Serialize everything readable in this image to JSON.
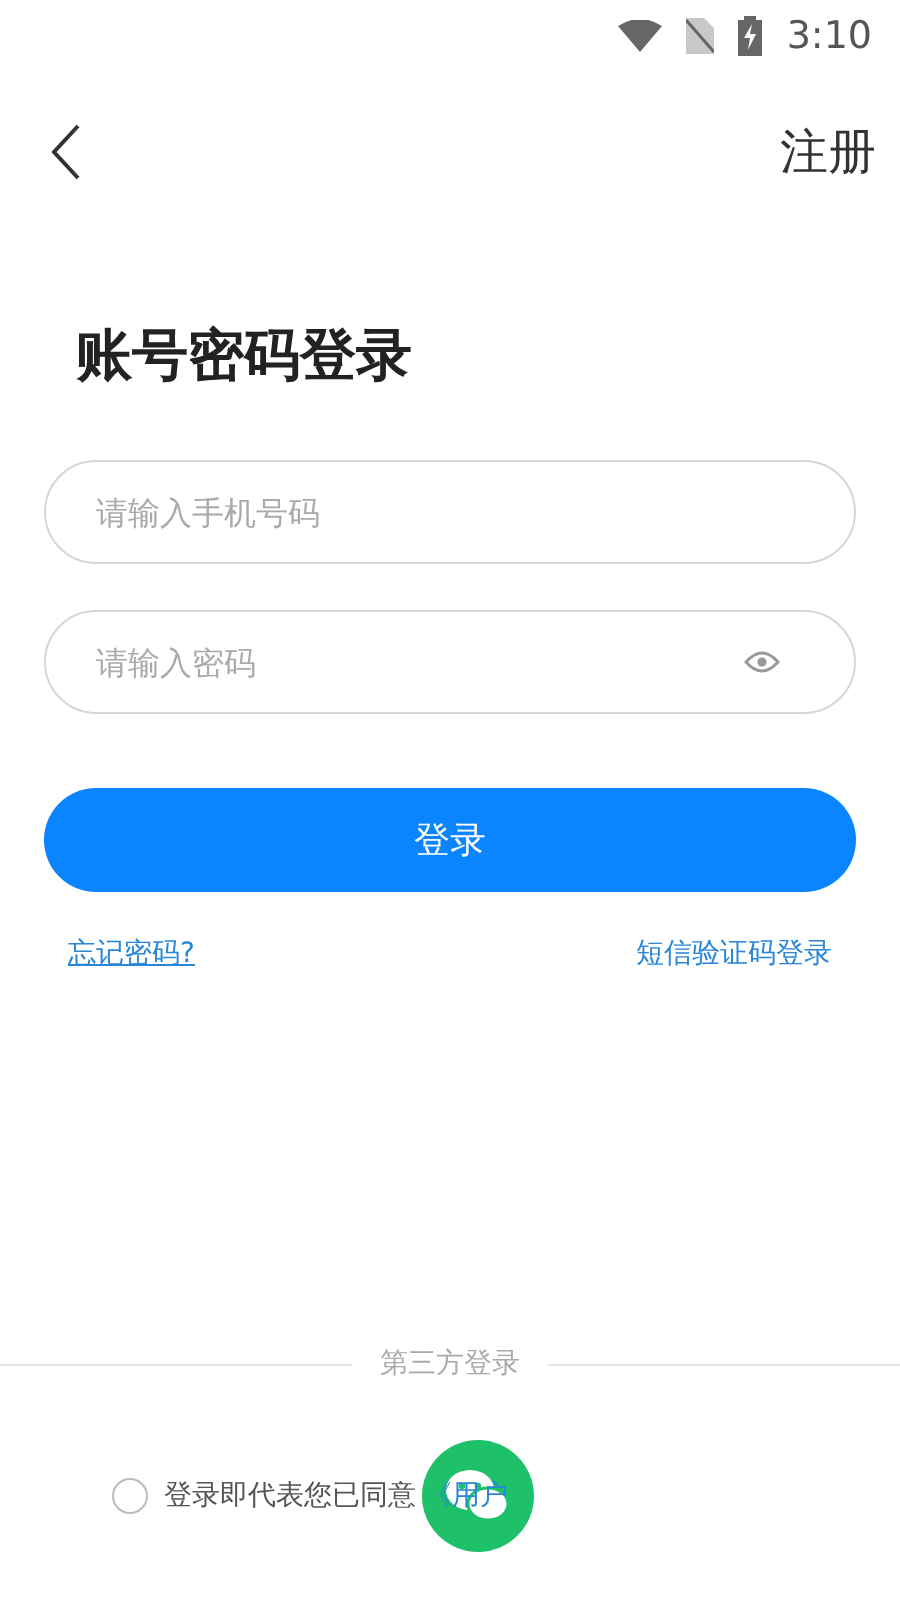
{
  "status_bar": {
    "time": "3:10"
  },
  "nav": {
    "action": "注册"
  },
  "title": "账号密码登录",
  "fields": [
    {
      "kind": "phone",
      "placeholder": "请输入手机号码"
    },
    {
      "kind": "password",
      "placeholder": "请输入密码"
    }
  ],
  "login_button": "登录",
  "links": {
    "forgot": "忘记密码?",
    "sms": "短信验证码登录"
  },
  "third_party": {
    "label": "第三方登录"
  },
  "agreement": {
    "checked": false,
    "text": "登录即代表您已同意",
    "link": "《用户"
  }
}
